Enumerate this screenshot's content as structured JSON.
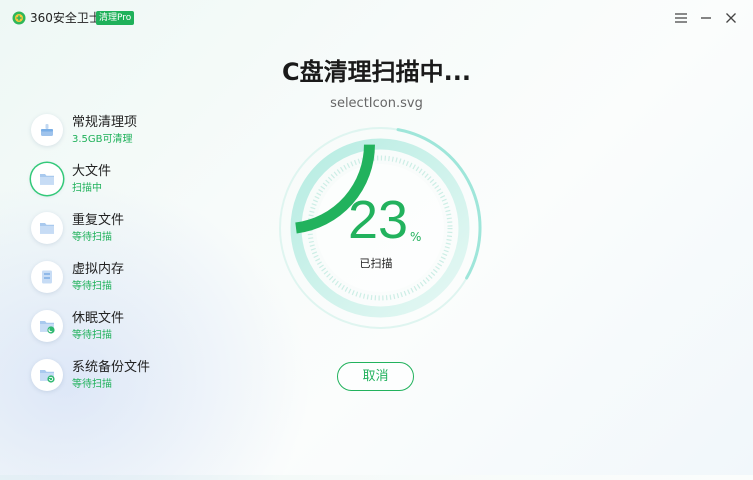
{
  "app": {
    "name": "360安全卫士",
    "edition": "清理Pro"
  },
  "scan": {
    "title": "C盘清理扫描中...",
    "subtitle": "selectIcon.svg",
    "progress_percent": 23,
    "percent_display": "23",
    "percent_unit": "%",
    "status_label": "已扫描",
    "cancel_label": "取消"
  },
  "items": [
    {
      "name": "常规清理项",
      "status": "3.5GB可清理",
      "icon": "broom-icon"
    },
    {
      "name": "大文件",
      "status": "扫描中",
      "icon": "folder-icon"
    },
    {
      "name": "重复文件",
      "status": "等待扫描",
      "icon": "folder-icon"
    },
    {
      "name": "虚拟内存",
      "status": "等待扫描",
      "icon": "memory-icon"
    },
    {
      "name": "休眠文件",
      "status": "等待扫描",
      "icon": "folder-moon-icon"
    },
    {
      "name": "系统备份文件",
      "status": "等待扫描",
      "icon": "folder-backup-icon"
    }
  ],
  "colors": {
    "accent": "#22b25d",
    "ring_light": "#bfeee6"
  }
}
